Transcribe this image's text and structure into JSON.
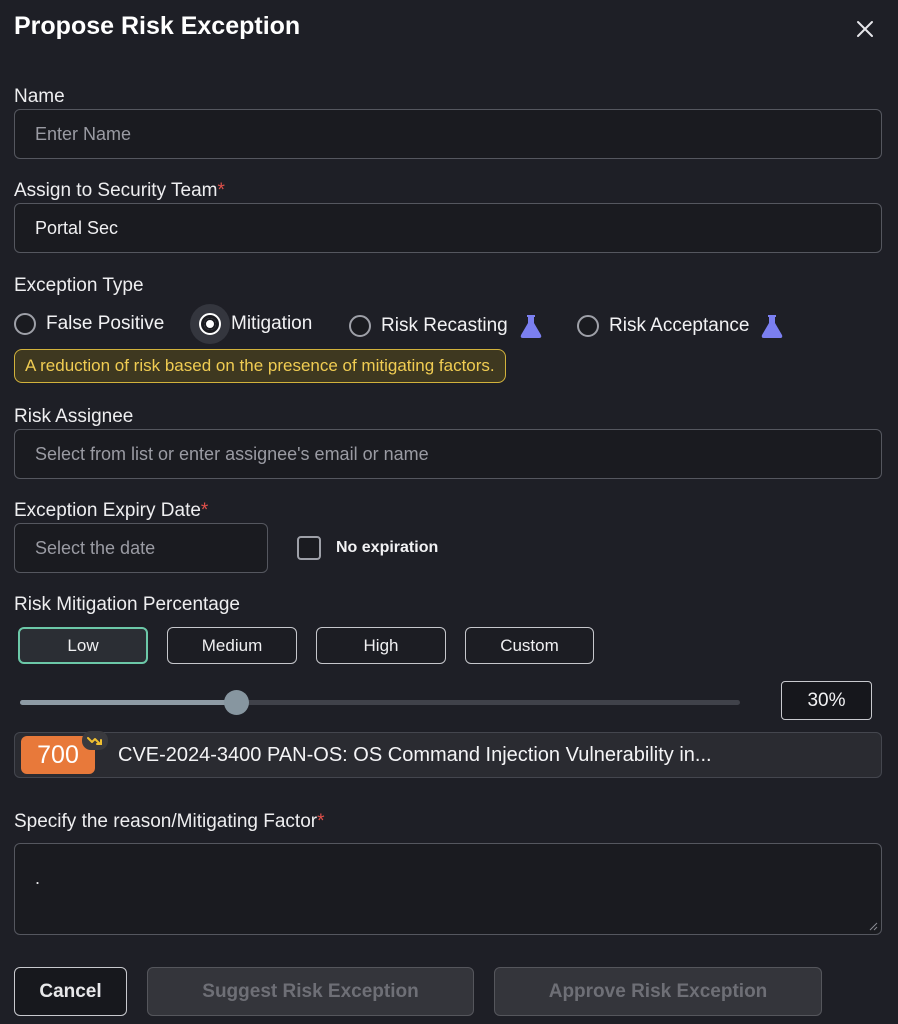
{
  "dialog": {
    "title": "Propose Risk Exception"
  },
  "name": {
    "label": "Name",
    "placeholder": "Enter Name",
    "value": ""
  },
  "team": {
    "label": "Assign to Security Team",
    "required_mark": "*",
    "value": "Portal Sec"
  },
  "exception_type": {
    "label": "Exception Type",
    "options": [
      {
        "label": "False Positive",
        "selected": false
      },
      {
        "label": "Mitigation",
        "selected": true
      },
      {
        "label": "Risk Recasting",
        "selected": false,
        "icon": "flask-icon"
      },
      {
        "label": "Risk Acceptance",
        "selected": false,
        "icon": "flask-icon"
      }
    ],
    "hint": "A reduction of risk based on the presence of mitigating factors."
  },
  "assignee": {
    "label": "Risk Assignee",
    "placeholder": "Select from list or enter assignee's email or name"
  },
  "expiry": {
    "label": "Exception Expiry Date",
    "required_mark": "*",
    "placeholder": "Select the date",
    "no_expiration_label": "No expiration",
    "no_expiration_checked": false
  },
  "mitigation": {
    "label": "Risk Mitigation Percentage",
    "presets": [
      "Low",
      "Medium",
      "High",
      "Custom"
    ],
    "active_preset": "Low",
    "percent_text": "30%",
    "percent_value": 0.3
  },
  "cve": {
    "score": "700",
    "text": "CVE-2024-3400 PAN-OS: OS Command Injection Vulnerability in..."
  },
  "reason": {
    "label": "Specify the reason/Mitigating Factor",
    "required_mark": "*",
    "value": "."
  },
  "actions": {
    "cancel": "Cancel",
    "suggest": "Suggest Risk Exception",
    "approve": "Approve Risk Exception"
  },
  "colors": {
    "accent_active": "#6cc8a8",
    "hint_text": "#f0cc52",
    "score_bg": "#e8793a",
    "flask": "#7b7ff0",
    "required": "#e0504a"
  }
}
